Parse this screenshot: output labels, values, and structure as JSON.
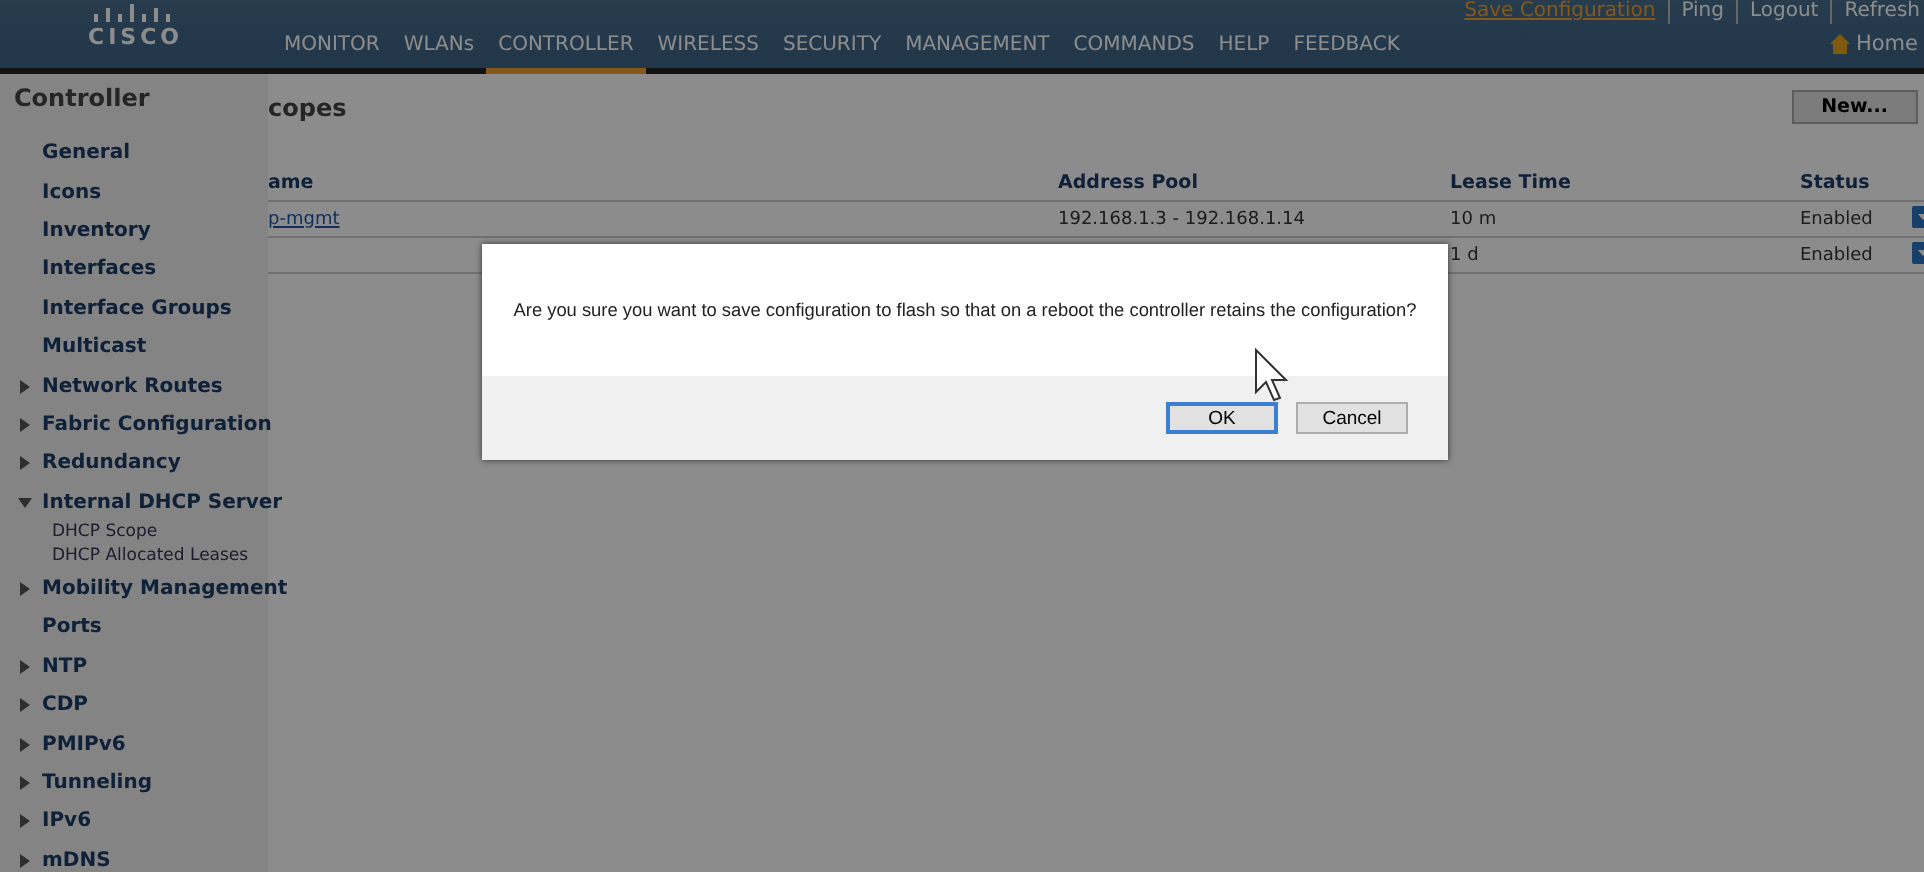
{
  "header": {
    "logo": "CISCO",
    "top_links": [
      {
        "label": "Save Configuration",
        "kind": "highlight"
      },
      {
        "label": "Ping",
        "kind": "plain"
      },
      {
        "label": "Logout",
        "kind": "plain"
      },
      {
        "label": "Refresh",
        "kind": "plain"
      }
    ],
    "nav": [
      {
        "label": "MONITOR",
        "selected": false
      },
      {
        "label": "WLANs",
        "selected": false
      },
      {
        "label": "CONTROLLER",
        "selected": true
      },
      {
        "label": "WIRELESS",
        "selected": false
      },
      {
        "label": "SECURITY",
        "selected": false
      },
      {
        "label": "MANAGEMENT",
        "selected": false
      },
      {
        "label": "COMMANDS",
        "selected": false
      },
      {
        "label": "HELP",
        "selected": false
      },
      {
        "label": "FEEDBACK",
        "selected": false
      }
    ],
    "home": "Home"
  },
  "sidebar": {
    "title": "Controller",
    "items": [
      {
        "label": "General",
        "kind": "leaf"
      },
      {
        "label": "Icons",
        "kind": "leaf"
      },
      {
        "label": "Inventory",
        "kind": "leaf"
      },
      {
        "label": "Interfaces",
        "kind": "leaf"
      },
      {
        "label": "Interface Groups",
        "kind": "leaf"
      },
      {
        "label": "Multicast",
        "kind": "leaf"
      },
      {
        "label": "Network Routes",
        "kind": "folder",
        "expanded": false
      },
      {
        "label": "Fabric Configuration",
        "kind": "folder",
        "expanded": false
      },
      {
        "label": "Redundancy",
        "kind": "folder",
        "expanded": false
      },
      {
        "label": "Internal DHCP Server",
        "kind": "folder",
        "expanded": true,
        "children": [
          {
            "label": "DHCP Scope"
          },
          {
            "label": "DHCP Allocated Leases"
          }
        ]
      },
      {
        "label": "Mobility Management",
        "kind": "folder",
        "expanded": false
      },
      {
        "label": "Ports",
        "kind": "leaf"
      },
      {
        "label": "NTP",
        "kind": "folder",
        "expanded": false
      },
      {
        "label": "CDP",
        "kind": "folder",
        "expanded": false
      },
      {
        "label": "PMIPv6",
        "kind": "folder",
        "expanded": false
      },
      {
        "label": "Tunneling",
        "kind": "folder",
        "expanded": false
      },
      {
        "label": "IPv6",
        "kind": "folder",
        "expanded": false
      },
      {
        "label": "mDNS",
        "kind": "folder",
        "expanded": false
      }
    ]
  },
  "content": {
    "title": "copes",
    "new_button": "New...",
    "table": {
      "columns": [
        "ame",
        "Address Pool",
        "Lease Time",
        "Status"
      ],
      "rows": [
        {
          "name": "p-mgmt",
          "pool": "192.168.1.3 - 192.168.1.14",
          "lease": "10 m",
          "status": "Enabled"
        },
        {
          "name": "",
          "pool": "",
          "lease": "1 d",
          "status": "Enabled"
        }
      ]
    }
  },
  "dialog": {
    "message": "Are you sure you want to save configuration to flash so that on a reboot the controller retains the configuration?",
    "buttons": [
      {
        "label": "OK",
        "focused": true
      },
      {
        "label": "Cancel",
        "focused": false
      }
    ]
  }
}
